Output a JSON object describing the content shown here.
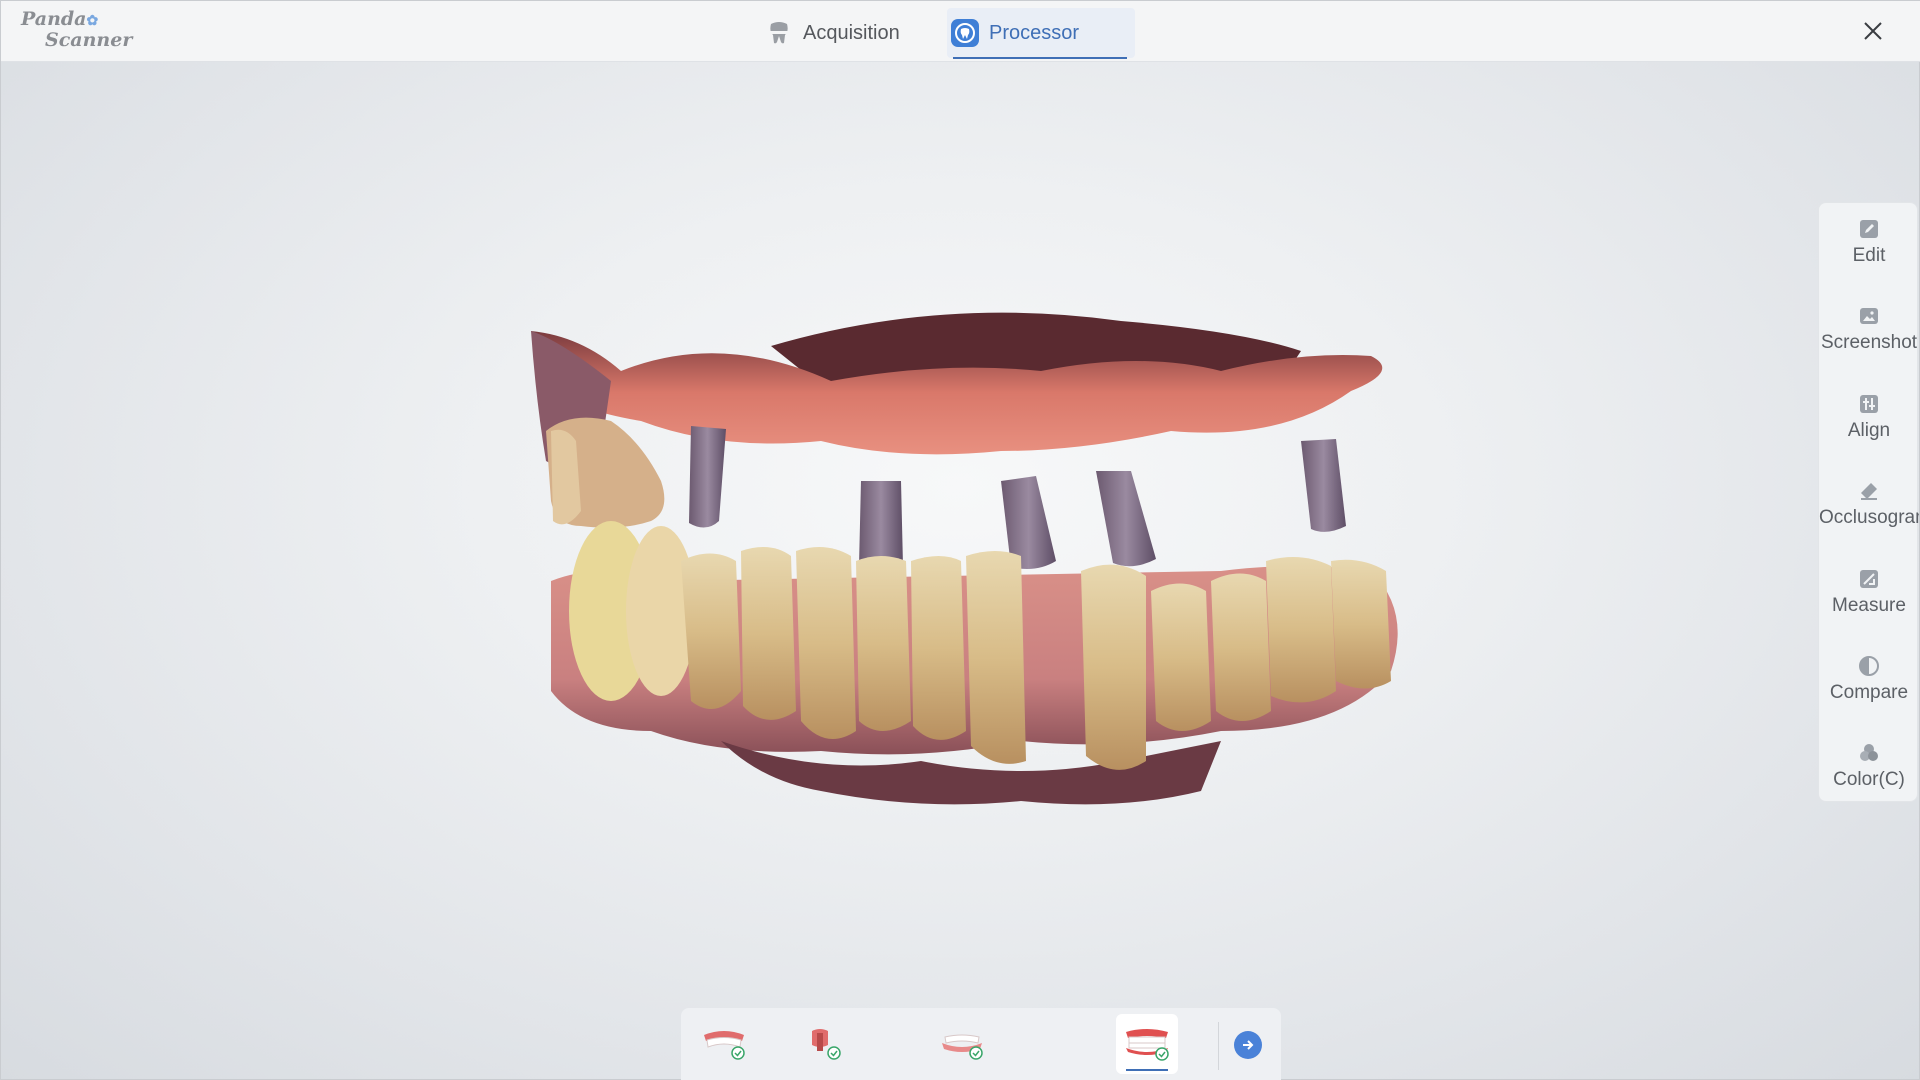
{
  "app": {
    "logo_line1": "Panda",
    "logo_line2": "Scanner"
  },
  "tabs": [
    {
      "label": "Acquisition",
      "icon": "tooth-icon",
      "active": false
    },
    {
      "label": "Processor",
      "icon": "processor-icon",
      "active": true
    }
  ],
  "right_toolbar": [
    {
      "label": "Edit",
      "icon": "edit-icon"
    },
    {
      "label": "Screenshot",
      "icon": "screenshot-icon"
    },
    {
      "label": "Align",
      "icon": "align-icon"
    },
    {
      "label": "Occlusogram",
      "icon": "occlusogram-icon"
    },
    {
      "label": "Measure",
      "icon": "measure-icon"
    },
    {
      "label": "Compare",
      "icon": "compare-icon"
    },
    {
      "label": "Color(C)",
      "icon": "color-icon"
    }
  ],
  "bottom_steps": [
    {
      "icon": "upper-jaw-icon",
      "done": true,
      "active": false
    },
    {
      "icon": "scan-body-icon",
      "done": true,
      "active": false
    },
    {
      "icon": "lower-jaw-icon",
      "done": true,
      "active": false
    },
    {
      "icon": "bite-icon",
      "done": true,
      "active": true
    }
  ],
  "colors": {
    "accent": "#3f6fb6",
    "done_check": "#3aa66a"
  }
}
